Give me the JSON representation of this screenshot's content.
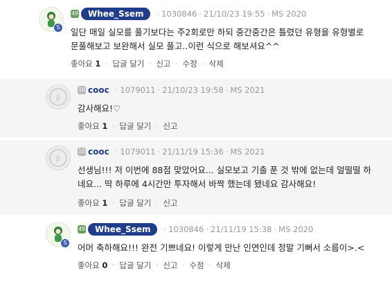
{
  "comments": [
    {
      "level": "49",
      "author": "Whee_Ssem",
      "id": "1030846",
      "date": "21/10/23 19:55",
      "ms": "MS 2020",
      "lines": [
        "일단 매일 실모를 풀기보다는 주2회로만 하되 중간중간은 틀렸던 유형을 유형별로",
        "문풀해보고 보완해서 실모 풀고..이런 식으로 해보셔요^^"
      ],
      "like_label": "좋아요",
      "like_count": "1",
      "reply_label": "답글 달기",
      "report_label": "신고",
      "edit_label": "수정",
      "delete_label": "삭제"
    },
    {
      "level": "10",
      "author": "cooc",
      "id": "1079011",
      "date": "21/10/23 19:58",
      "ms": "MS 2021",
      "lines": [
        "감사해요!♡"
      ],
      "like_label": "좋아요",
      "like_count": "1",
      "reply_label": "답글 달기",
      "report_label": "신고"
    },
    {
      "level": "10",
      "author": "cooc",
      "id": "1079011",
      "date": "21/11/19 15:36",
      "ms": "MS 2021",
      "lines": [
        "선생님!!! 저 이번에 88점 맞았어요... 실모보고 기출 푼 것 밖에 없는데 얼떨떨 하",
        "네요... 딱 하루에 4시간만 투자해서 바짝 했는데 됐네요 감사해요!"
      ],
      "like_label": "좋아요",
      "like_count": "1",
      "reply_label": "답글 달기",
      "report_label": "신고"
    },
    {
      "level": "49",
      "author": "Whee_Ssem",
      "id": "1030846",
      "date": "21/11/19 15:38",
      "ms": "MS 2020",
      "lines": [
        "어머 축하해요!!! 완전 기쁘네요! 이렇게 만난 인연인데 정말 기뻐서 소름이>.<"
      ],
      "like_label": "좋아요",
      "like_count": "0",
      "reply_label": "답글 달기",
      "report_label": "신고",
      "edit_label": "수정",
      "delete_label": "삭제"
    }
  ],
  "icons": {
    "avatar_green": "green-character-avatar",
    "avatar_grey": "grey-default-avatar"
  },
  "colors": {
    "author_pill": "#1f3d8a",
    "level_green": "#6b9e5c",
    "reply_bg": "#f5f5f5"
  }
}
